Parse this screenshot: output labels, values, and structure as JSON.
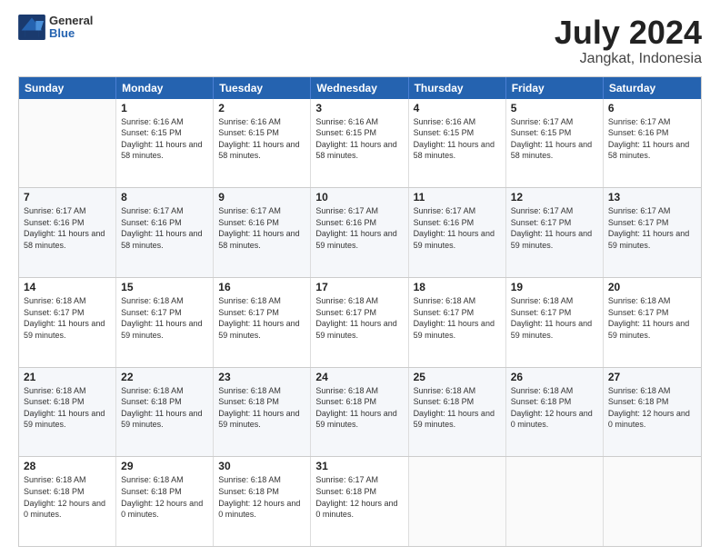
{
  "logo": {
    "line1": "General",
    "line2": "Blue"
  },
  "title": "July 2024",
  "subtitle": "Jangkat, Indonesia",
  "days_of_week": [
    "Sunday",
    "Monday",
    "Tuesday",
    "Wednesday",
    "Thursday",
    "Friday",
    "Saturday"
  ],
  "weeks": [
    [
      {
        "day": "",
        "sunrise": "",
        "sunset": "",
        "daylight": ""
      },
      {
        "day": "1",
        "sunrise": "Sunrise: 6:16 AM",
        "sunset": "Sunset: 6:15 PM",
        "daylight": "Daylight: 11 hours and 58 minutes."
      },
      {
        "day": "2",
        "sunrise": "Sunrise: 6:16 AM",
        "sunset": "Sunset: 6:15 PM",
        "daylight": "Daylight: 11 hours and 58 minutes."
      },
      {
        "day": "3",
        "sunrise": "Sunrise: 6:16 AM",
        "sunset": "Sunset: 6:15 PM",
        "daylight": "Daylight: 11 hours and 58 minutes."
      },
      {
        "day": "4",
        "sunrise": "Sunrise: 6:16 AM",
        "sunset": "Sunset: 6:15 PM",
        "daylight": "Daylight: 11 hours and 58 minutes."
      },
      {
        "day": "5",
        "sunrise": "Sunrise: 6:17 AM",
        "sunset": "Sunset: 6:15 PM",
        "daylight": "Daylight: 11 hours and 58 minutes."
      },
      {
        "day": "6",
        "sunrise": "Sunrise: 6:17 AM",
        "sunset": "Sunset: 6:16 PM",
        "daylight": "Daylight: 11 hours and 58 minutes."
      }
    ],
    [
      {
        "day": "7",
        "sunrise": "Sunrise: 6:17 AM",
        "sunset": "Sunset: 6:16 PM",
        "daylight": "Daylight: 11 hours and 58 minutes."
      },
      {
        "day": "8",
        "sunrise": "Sunrise: 6:17 AM",
        "sunset": "Sunset: 6:16 PM",
        "daylight": "Daylight: 11 hours and 58 minutes."
      },
      {
        "day": "9",
        "sunrise": "Sunrise: 6:17 AM",
        "sunset": "Sunset: 6:16 PM",
        "daylight": "Daylight: 11 hours and 58 minutes."
      },
      {
        "day": "10",
        "sunrise": "Sunrise: 6:17 AM",
        "sunset": "Sunset: 6:16 PM",
        "daylight": "Daylight: 11 hours and 59 minutes."
      },
      {
        "day": "11",
        "sunrise": "Sunrise: 6:17 AM",
        "sunset": "Sunset: 6:16 PM",
        "daylight": "Daylight: 11 hours and 59 minutes."
      },
      {
        "day": "12",
        "sunrise": "Sunrise: 6:17 AM",
        "sunset": "Sunset: 6:17 PM",
        "daylight": "Daylight: 11 hours and 59 minutes."
      },
      {
        "day": "13",
        "sunrise": "Sunrise: 6:17 AM",
        "sunset": "Sunset: 6:17 PM",
        "daylight": "Daylight: 11 hours and 59 minutes."
      }
    ],
    [
      {
        "day": "14",
        "sunrise": "Sunrise: 6:18 AM",
        "sunset": "Sunset: 6:17 PM",
        "daylight": "Daylight: 11 hours and 59 minutes."
      },
      {
        "day": "15",
        "sunrise": "Sunrise: 6:18 AM",
        "sunset": "Sunset: 6:17 PM",
        "daylight": "Daylight: 11 hours and 59 minutes."
      },
      {
        "day": "16",
        "sunrise": "Sunrise: 6:18 AM",
        "sunset": "Sunset: 6:17 PM",
        "daylight": "Daylight: 11 hours and 59 minutes."
      },
      {
        "day": "17",
        "sunrise": "Sunrise: 6:18 AM",
        "sunset": "Sunset: 6:17 PM",
        "daylight": "Daylight: 11 hours and 59 minutes."
      },
      {
        "day": "18",
        "sunrise": "Sunrise: 6:18 AM",
        "sunset": "Sunset: 6:17 PM",
        "daylight": "Daylight: 11 hours and 59 minutes."
      },
      {
        "day": "19",
        "sunrise": "Sunrise: 6:18 AM",
        "sunset": "Sunset: 6:17 PM",
        "daylight": "Daylight: 11 hours and 59 minutes."
      },
      {
        "day": "20",
        "sunrise": "Sunrise: 6:18 AM",
        "sunset": "Sunset: 6:17 PM",
        "daylight": "Daylight: 11 hours and 59 minutes."
      }
    ],
    [
      {
        "day": "21",
        "sunrise": "Sunrise: 6:18 AM",
        "sunset": "Sunset: 6:18 PM",
        "daylight": "Daylight: 11 hours and 59 minutes."
      },
      {
        "day": "22",
        "sunrise": "Sunrise: 6:18 AM",
        "sunset": "Sunset: 6:18 PM",
        "daylight": "Daylight: 11 hours and 59 minutes."
      },
      {
        "day": "23",
        "sunrise": "Sunrise: 6:18 AM",
        "sunset": "Sunset: 6:18 PM",
        "daylight": "Daylight: 11 hours and 59 minutes."
      },
      {
        "day": "24",
        "sunrise": "Sunrise: 6:18 AM",
        "sunset": "Sunset: 6:18 PM",
        "daylight": "Daylight: 11 hours and 59 minutes."
      },
      {
        "day": "25",
        "sunrise": "Sunrise: 6:18 AM",
        "sunset": "Sunset: 6:18 PM",
        "daylight": "Daylight: 11 hours and 59 minutes."
      },
      {
        "day": "26",
        "sunrise": "Sunrise: 6:18 AM",
        "sunset": "Sunset: 6:18 PM",
        "daylight": "Daylight: 12 hours and 0 minutes."
      },
      {
        "day": "27",
        "sunrise": "Sunrise: 6:18 AM",
        "sunset": "Sunset: 6:18 PM",
        "daylight": "Daylight: 12 hours and 0 minutes."
      }
    ],
    [
      {
        "day": "28",
        "sunrise": "Sunrise: 6:18 AM",
        "sunset": "Sunset: 6:18 PM",
        "daylight": "Daylight: 12 hours and 0 minutes."
      },
      {
        "day": "29",
        "sunrise": "Sunrise: 6:18 AM",
        "sunset": "Sunset: 6:18 PM",
        "daylight": "Daylight: 12 hours and 0 minutes."
      },
      {
        "day": "30",
        "sunrise": "Sunrise: 6:18 AM",
        "sunset": "Sunset: 6:18 PM",
        "daylight": "Daylight: 12 hours and 0 minutes."
      },
      {
        "day": "31",
        "sunrise": "Sunrise: 6:17 AM",
        "sunset": "Sunset: 6:18 PM",
        "daylight": "Daylight: 12 hours and 0 minutes."
      },
      {
        "day": "",
        "sunrise": "",
        "sunset": "",
        "daylight": ""
      },
      {
        "day": "",
        "sunrise": "",
        "sunset": "",
        "daylight": ""
      },
      {
        "day": "",
        "sunrise": "",
        "sunset": "",
        "daylight": ""
      }
    ]
  ]
}
